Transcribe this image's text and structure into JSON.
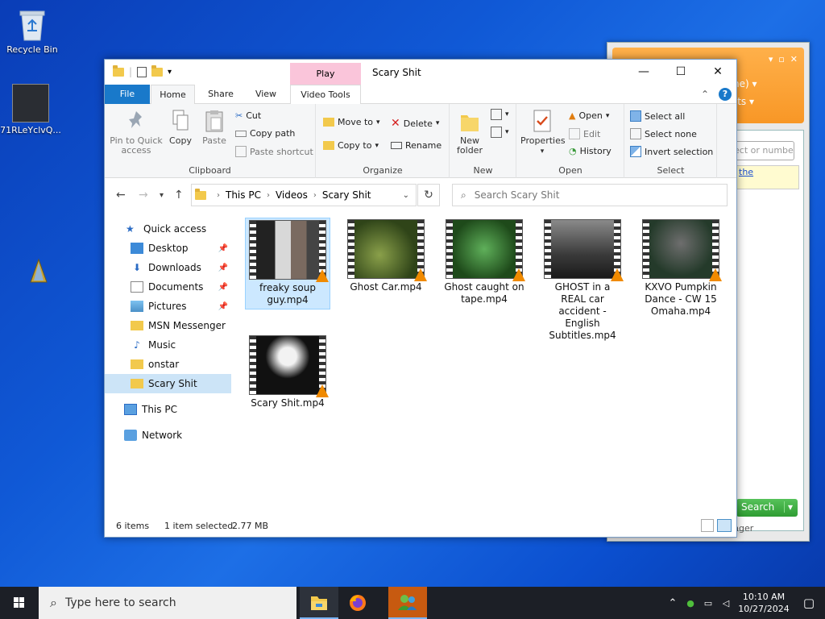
{
  "desktop": {
    "icons": [
      {
        "label": "Recycle Bin"
      },
      {
        "label": "71RLeYclvQ..."
      }
    ]
  },
  "msn": {
    "search_placeholder": "ect or numbe",
    "link_fragment": "the",
    "search_button": "Search",
    "footer_fragment": "nger",
    "banner_line1": "ne) ▾",
    "banner_line2": "nuts ▾"
  },
  "explorer": {
    "title": "Scary Shit",
    "contextual_tab_header": "Play",
    "tabs": {
      "file": "File",
      "home": "Home",
      "share": "Share",
      "view": "View",
      "video_tools": "Video Tools"
    },
    "ribbon": {
      "clipboard": {
        "label": "Clipboard",
        "pin": "Pin to Quick access",
        "copy": "Copy",
        "paste": "Paste",
        "cut": "Cut",
        "copy_path": "Copy path",
        "paste_shortcut": "Paste shortcut"
      },
      "organize": {
        "label": "Organize",
        "move_to": "Move to",
        "copy_to": "Copy to",
        "delete": "Delete",
        "rename": "Rename"
      },
      "new": {
        "label": "New",
        "new_folder": "New folder"
      },
      "open": {
        "label": "Open",
        "properties": "Properties",
        "open": "Open",
        "edit": "Edit",
        "history": "History"
      },
      "select": {
        "label": "Select",
        "select_all": "Select all",
        "select_none": "Select none",
        "invert": "Invert selection"
      }
    },
    "address": {
      "crumbs": [
        "This PC",
        "Videos",
        "Scary Shit"
      ]
    },
    "search_placeholder": "Search Scary Shit",
    "nav": {
      "quick_access": "Quick access",
      "items": [
        {
          "label": "Desktop",
          "pinned": true
        },
        {
          "label": "Downloads",
          "pinned": true
        },
        {
          "label": "Documents",
          "pinned": true
        },
        {
          "label": "Pictures",
          "pinned": true
        },
        {
          "label": "MSN Messenger",
          "pinned": false
        },
        {
          "label": "Music",
          "pinned": false
        },
        {
          "label": "onstar",
          "pinned": false
        },
        {
          "label": "Scary Shit",
          "pinned": false
        }
      ],
      "this_pc": "This PC",
      "network": "Network"
    },
    "files": [
      {
        "name": "freaky soup guy.mp4",
        "selected": true
      },
      {
        "name": "Ghost Car.mp4",
        "selected": false
      },
      {
        "name": "Ghost caught on tape.mp4",
        "selected": false
      },
      {
        "name": "GHOST in a REAL car accident - English Subtitles.mp4",
        "selected": false
      },
      {
        "name": "KXVO Pumpkin Dance - CW 15 Omaha.mp4",
        "selected": false
      },
      {
        "name": "Scary Shit.mp4",
        "selected": false
      }
    ],
    "status": {
      "count": "6 items",
      "selection": "1 item selected",
      "size": "2.77 MB"
    }
  },
  "taskbar": {
    "search_placeholder": "Type here to search",
    "time": "10:10 AM",
    "date": "10/27/2024"
  }
}
